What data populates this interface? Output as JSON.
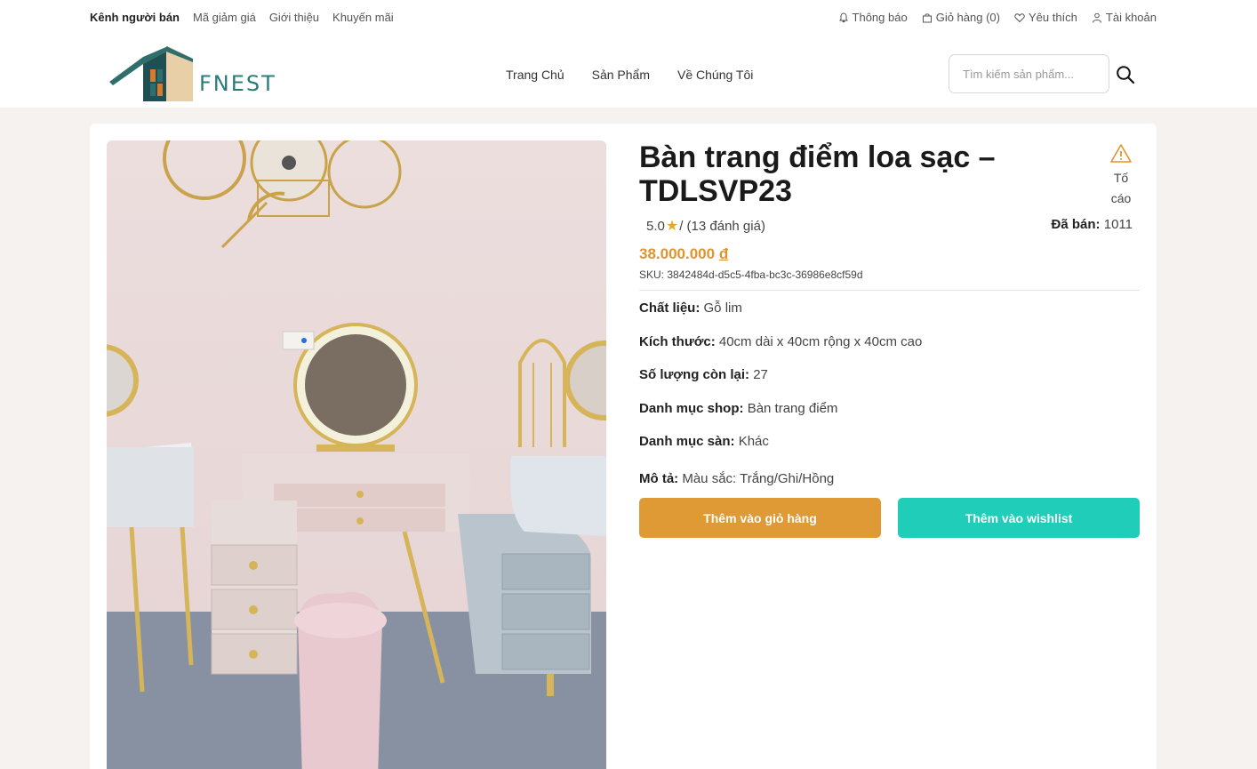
{
  "topbar": {
    "left_links": [
      "Kênh người bán",
      "Mã giảm giá",
      "Giới thiệu",
      "Khuyến mãi"
    ],
    "notifications": "Thông báo",
    "cart": "Giỏ hàng (0)",
    "wishlist": "Yêu thích",
    "account": "Tài khoản"
  },
  "header": {
    "logo_text": "FNEST",
    "nav": [
      "Trang Chủ",
      "Sản Phẩm",
      "Về Chúng Tôi"
    ],
    "search_placeholder": "Tìm kiếm sản phẩm..."
  },
  "product": {
    "title": "Bàn trang điểm loa sạc – TDLSVP23",
    "report_label_1": "Tố",
    "report_label_2": "cáo",
    "rating_value": "5.0",
    "rating_count": "/ (13 đánh giá)",
    "sold_label": "Đã bán:",
    "sold_value": "1011",
    "price": "38.000.000",
    "currency": "đ",
    "sku": "SKU: 3842484d-d5c5-4fba-bc3c-36986e8cf59d",
    "specs": [
      {
        "key": "Chất liệu:",
        "value": "Gỗ lim"
      },
      {
        "key": "Kích thước:",
        "value": "40cm dài x 40cm rộng x 40cm cao"
      },
      {
        "key": "Số lượng còn lại:",
        "value": "27"
      },
      {
        "key": "Danh mục shop:",
        "value": "Bàn trang điểm"
      },
      {
        "key": "Danh mục sàn:",
        "value": "Khác"
      },
      {
        "key": "Mô tả:",
        "value": "Màu sắc: Trắng/Ghi/Hồng"
      }
    ],
    "add_to_cart": "Thêm vào giỏ hàng",
    "add_to_wishlist": "Thêm vào wishlist"
  },
  "colors": {
    "accent_orange": "#df9935",
    "accent_teal": "#1fcdb8",
    "logo_teal": "#2b7c78",
    "rating_star": "#e8a824"
  },
  "icons": [
    "bell-icon",
    "bag-icon",
    "heart-icon",
    "user-icon",
    "search-icon",
    "warning-icon",
    "star-icon"
  ]
}
